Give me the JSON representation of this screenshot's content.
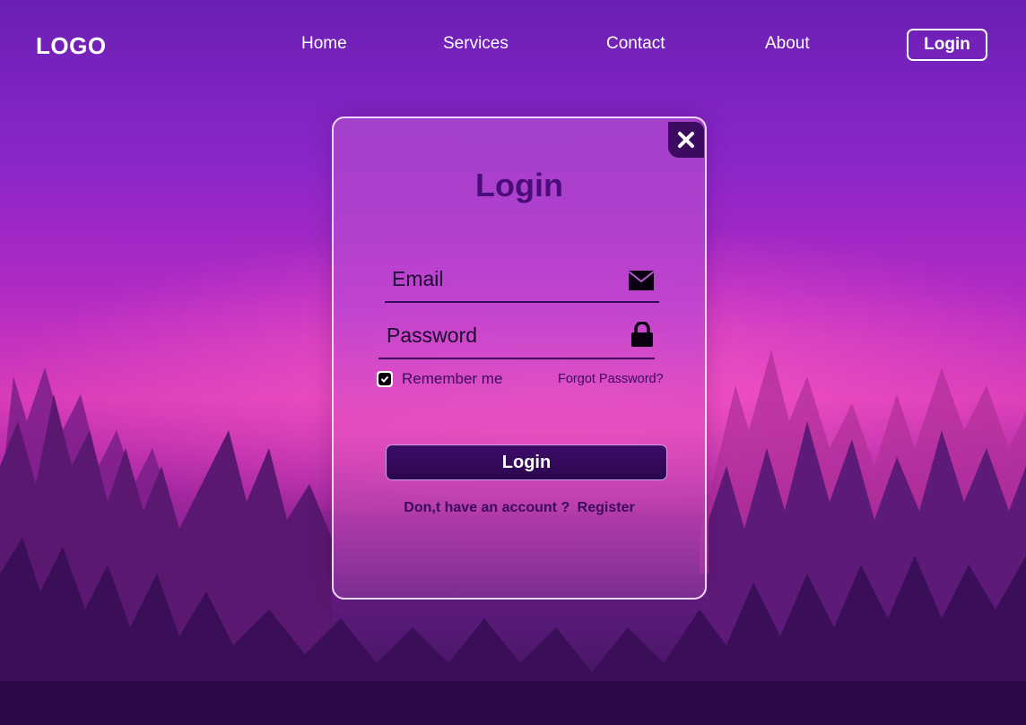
{
  "nav": {
    "logo": "LOGO",
    "links": [
      "Home",
      "Services",
      "Contact",
      "About"
    ],
    "login_button": "Login"
  },
  "modal": {
    "title": "Login",
    "email_placeholder": "Email",
    "password_placeholder": "Password",
    "remember_label": "Remember me",
    "remember_checked": true,
    "forgot_label": "Forgot Password?",
    "submit_label": "Login",
    "register_prompt": "Don,t have an account ?",
    "register_link": "Register"
  },
  "icons": {
    "close": "close-icon",
    "email": "envelope-icon",
    "password": "lock-icon",
    "checkbox": "check-icon"
  },
  "colors": {
    "accent_dark": "#3d0a62",
    "title_purple": "#4a0c78",
    "card_border": "#f3d7ff"
  }
}
